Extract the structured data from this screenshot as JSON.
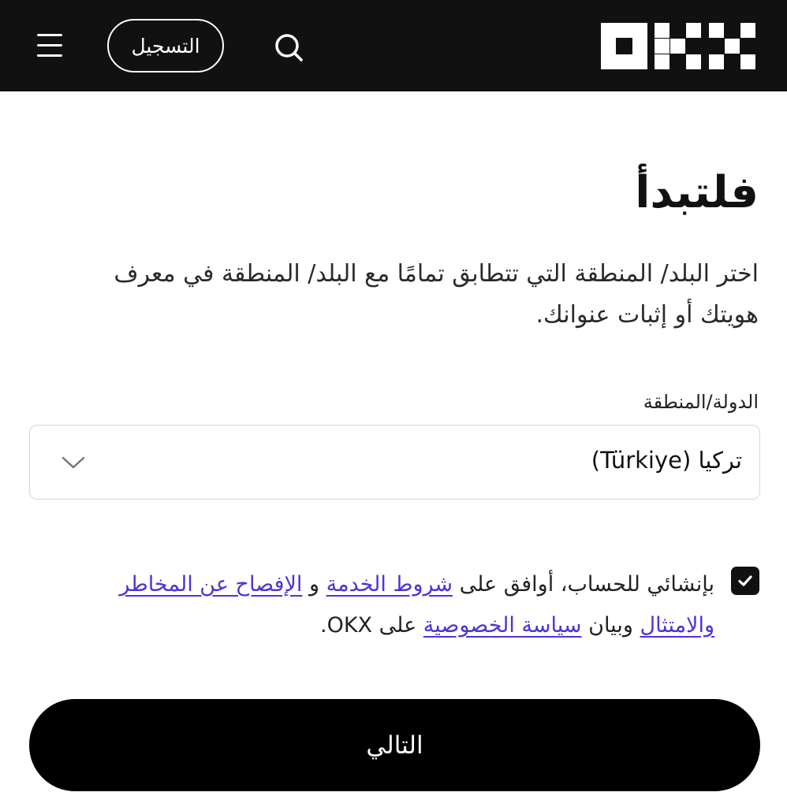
{
  "header": {
    "menu_icon": "hamburger-menu-icon",
    "signup_label": "التسجيل",
    "search_icon": "search-icon",
    "logo_text": "OKX",
    "background": "#111111"
  },
  "main": {
    "title": "فلتبدأ",
    "subtitle": "اختر البلد/ المنطقة التي تتطابق تمامًا مع البلد/ المنطقة في معرف هويتك أو إثبات عنوانك.",
    "country_field": {
      "label": "الدولة/المنطقة",
      "value": "تركيا (Türkiye)",
      "chevron_icon": "chevron-down-icon"
    },
    "consent": {
      "checked": true,
      "prefix": "بإنشائي للحساب، أوافق على ",
      "terms_link": "شروط الخدمة",
      "and": " و ",
      "risk_link": "الإفصاح عن المخاطر والامتثال",
      "and_privacy": " وبيان ",
      "privacy_link": "سياسة الخصوصية",
      "suffix": " على OKX."
    },
    "next_label": "التالي"
  },
  "colors": {
    "accent_link": "#4a35d6",
    "primary_button": "#000000",
    "text": "#111111"
  }
}
